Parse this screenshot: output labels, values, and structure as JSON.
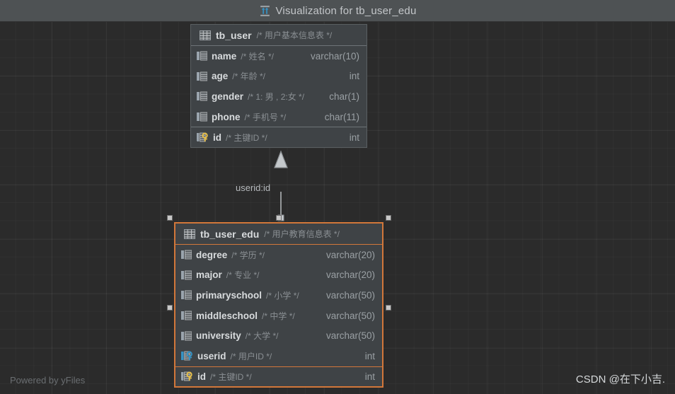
{
  "window": {
    "title": "Visualization for tb_user_edu",
    "icon": "visualization-icon",
    "titlebar_color": "#4e5254"
  },
  "canvas": {
    "background_color": "#2b2b2b",
    "grid": true,
    "selection_color": "#d2773a"
  },
  "diagram": {
    "type": "database-er-diagram",
    "tables": [
      {
        "id": "tb_user",
        "name": "tb_user",
        "comment": "/* 用户基本信息表 */",
        "icon": "table-icon",
        "selected": false,
        "columns": [
          {
            "name": "name",
            "comment": "/* 姓名 */",
            "type": "varchar(10)",
            "icon": "column-icon",
            "key": "none"
          },
          {
            "name": "age",
            "comment": "/* 年龄 */",
            "type": "int",
            "icon": "column-icon",
            "key": "none"
          },
          {
            "name": "gender",
            "comment": "/* 1: 男 , 2:女 */",
            "type": "char(1)",
            "icon": "column-icon",
            "key": "none"
          },
          {
            "name": "phone",
            "comment": "/* 手机号 */",
            "type": "char(11)",
            "icon": "column-icon",
            "key": "none"
          },
          {
            "name": "id",
            "comment": "/* 主键ID */",
            "type": "int",
            "icon": "primary-key-icon",
            "key": "primary"
          }
        ]
      },
      {
        "id": "tb_user_edu",
        "name": "tb_user_edu",
        "comment": "/* 用户教育信息表 */",
        "icon": "table-icon",
        "selected": true,
        "columns": [
          {
            "name": "degree",
            "comment": "/* 学历 */",
            "type": "varchar(20)",
            "icon": "column-icon",
            "key": "none"
          },
          {
            "name": "major",
            "comment": "/* 专业 */",
            "type": "varchar(20)",
            "icon": "column-icon",
            "key": "none"
          },
          {
            "name": "primaryschool",
            "comment": "/* 小学 */",
            "type": "varchar(50)",
            "icon": "column-icon",
            "key": "none"
          },
          {
            "name": "middleschool",
            "comment": "/* 中学 */",
            "type": "varchar(50)",
            "icon": "column-icon",
            "key": "none"
          },
          {
            "name": "university",
            "comment": "/* 大学 */",
            "type": "varchar(50)",
            "icon": "column-icon",
            "key": "none"
          },
          {
            "name": "userid",
            "comment": "/* 用户ID */",
            "type": "int",
            "icon": "foreign-key-icon",
            "key": "foreign"
          },
          {
            "name": "id",
            "comment": "/* 主键ID */",
            "type": "int",
            "icon": "primary-key-icon",
            "key": "primary"
          }
        ]
      }
    ],
    "relationships": [
      {
        "label": "userid:id",
        "from": "tb_user_edu",
        "to": "tb_user",
        "arrow": "hollow-triangle"
      }
    ]
  },
  "watermarks": {
    "left": "Powered by yFiles",
    "right": "CSDN @在下小吉."
  }
}
